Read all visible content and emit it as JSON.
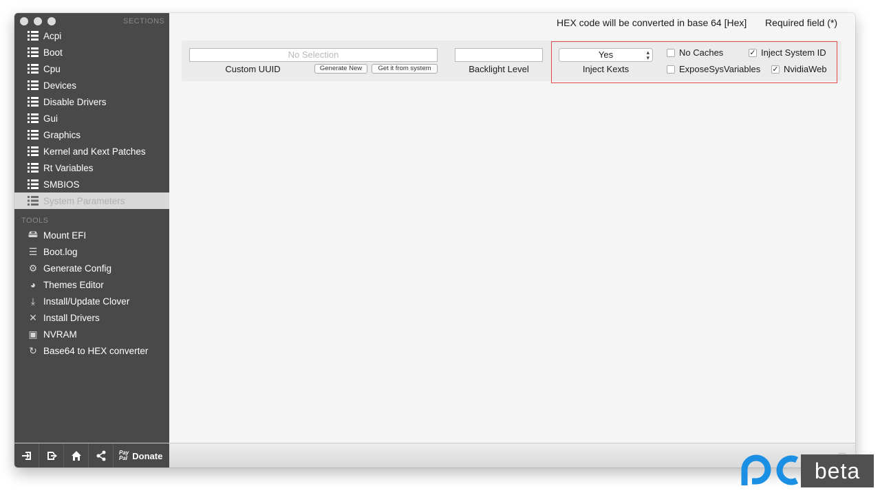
{
  "window": {
    "sidebar": {
      "sections_header": "SECTIONS",
      "sections": [
        {
          "label": "Acpi"
        },
        {
          "label": "Boot"
        },
        {
          "label": "Cpu"
        },
        {
          "label": "Devices"
        },
        {
          "label": "Disable Drivers"
        },
        {
          "label": "Gui"
        },
        {
          "label": "Graphics"
        },
        {
          "label": "Kernel and Kext Patches"
        },
        {
          "label": "Rt Variables"
        },
        {
          "label": "SMBIOS"
        },
        {
          "label": "System Parameters",
          "selected": true
        }
      ],
      "tools_header": "TOOLS",
      "tools": [
        {
          "label": "Mount EFI",
          "icon": "disk-icon"
        },
        {
          "label": "Boot.log",
          "icon": "log-icon"
        },
        {
          "label": "Generate Config",
          "icon": "gears-icon"
        },
        {
          "label": "Themes Editor",
          "icon": "palette-icon"
        },
        {
          "label": "Install/Update Clover",
          "icon": "download-icon"
        },
        {
          "label": "Install Drivers",
          "icon": "tools-icon"
        },
        {
          "label": "NVRAM",
          "icon": "chip-icon"
        },
        {
          "label": "Base64 to HEX converter",
          "icon": "refresh-icon"
        }
      ]
    },
    "header": {
      "hex_note": "HEX code will be converted in base 64 [Hex]",
      "required_note": "Required field (*)"
    },
    "panel": {
      "custom_uuid": {
        "placeholder": "No Selection",
        "label": "Custom UUID",
        "generate_button": "Generate New",
        "system_button": "Get it from system"
      },
      "backlight": {
        "label": "Backlight Level",
        "value": ""
      },
      "inject_kexts": {
        "label": "Inject Kexts",
        "value": "Yes"
      },
      "checkboxes": [
        {
          "label": "No Caches",
          "checked": false
        },
        {
          "label": "Inject System ID",
          "checked": true
        },
        {
          "label": "ExposeSysVariables",
          "checked": false
        },
        {
          "label": "NvidiaWeb",
          "checked": true
        }
      ]
    },
    "bottom": {
      "paypal_top": "Pay",
      "paypal_bottom": "Pal",
      "donate_label": "Donate"
    }
  },
  "watermark": {
    "beta_label": "beta"
  },
  "colors": {
    "sidebar_bg": "#494949",
    "highlight": "#e04848",
    "logo_blue": "#1a8fe3"
  }
}
